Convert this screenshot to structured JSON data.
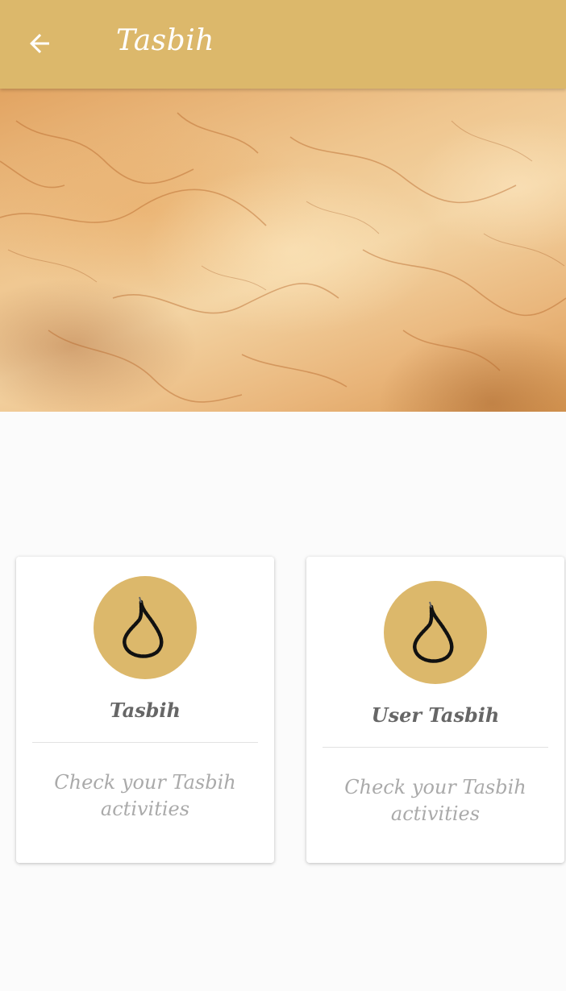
{
  "header": {
    "title": "Tasbih",
    "back_icon": "arrow-left-icon",
    "background_color": "#dcb86b"
  },
  "banner": {
    "description_icon": "parchment-texture"
  },
  "cards": [
    {
      "title": "Tasbih",
      "subtitle": "Check your Tasbih activities",
      "icon": "prayer-beads-icon"
    },
    {
      "title": "User Tasbih",
      "subtitle": "Check your Tasbih activities",
      "icon": "prayer-beads-icon"
    }
  ],
  "colors": {
    "accent": "#dcb86b",
    "card_title": "#666666",
    "card_subtitle": "#aaaaaa",
    "page_background": "#fbfbfb"
  }
}
